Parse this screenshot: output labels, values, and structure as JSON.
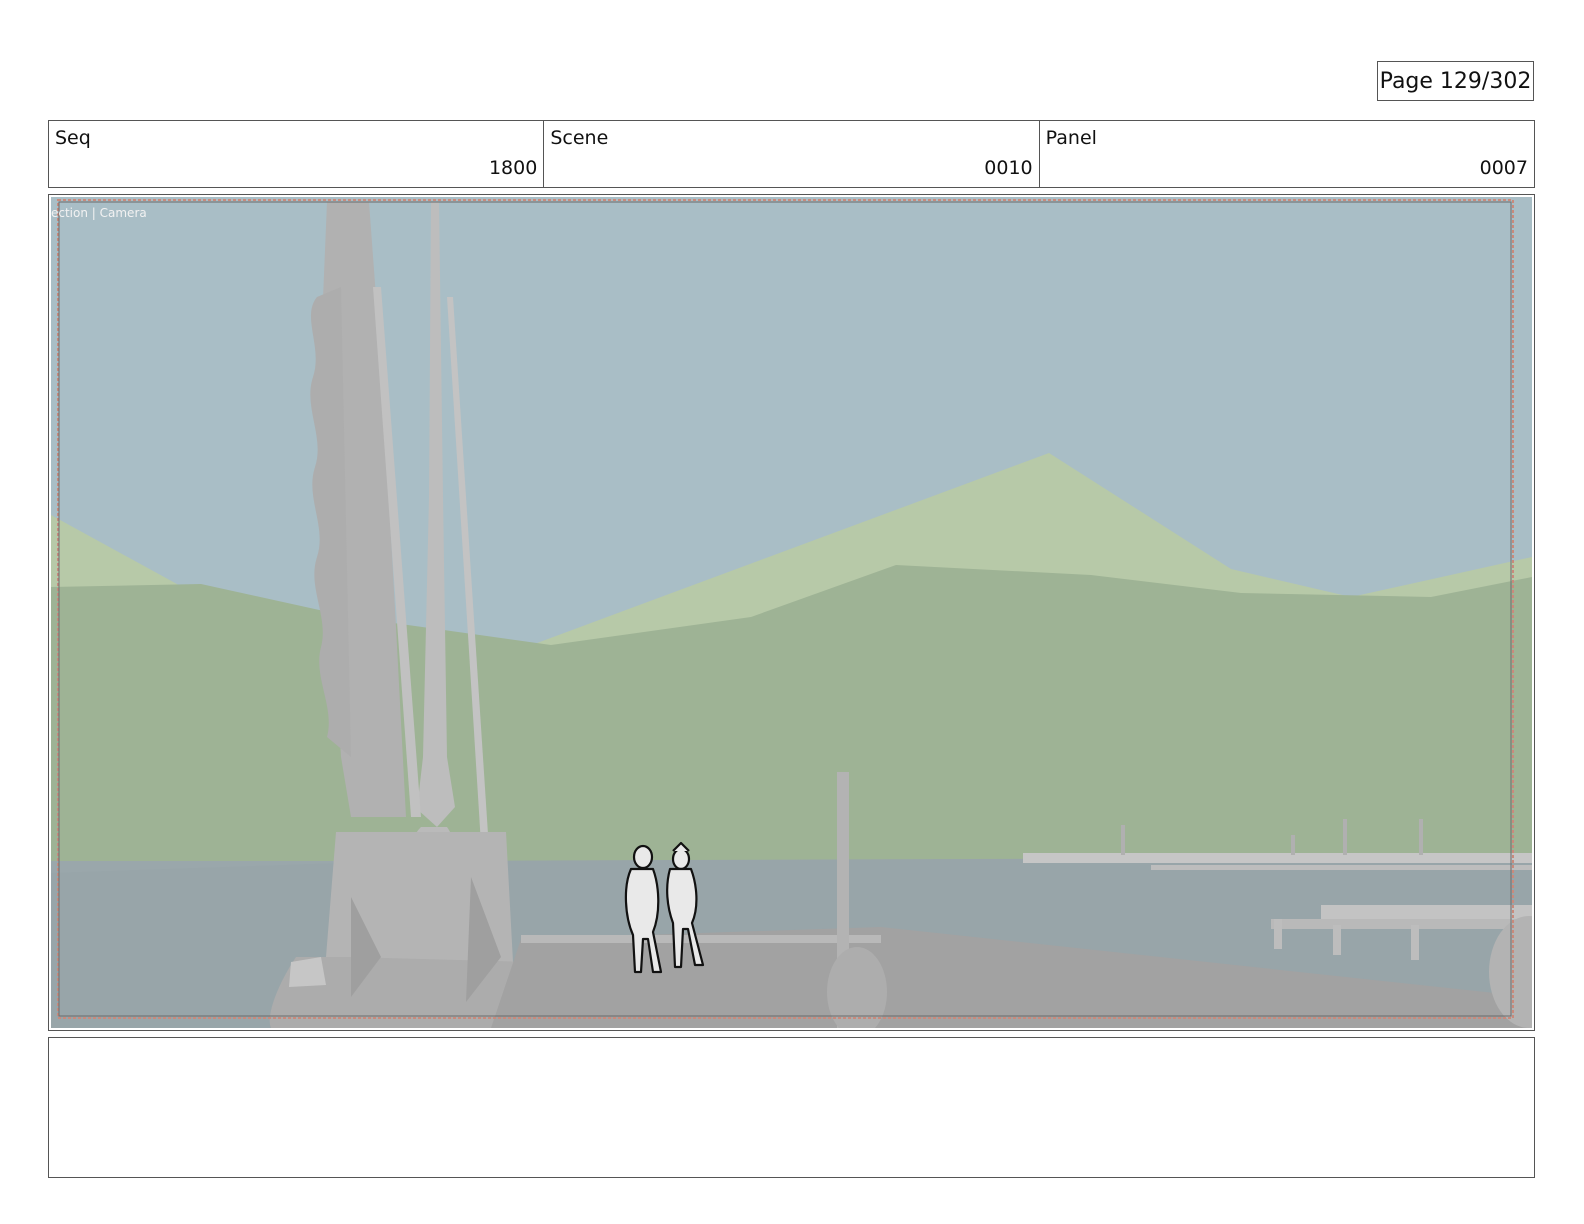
{
  "page": {
    "label": "Page 129/302"
  },
  "header": {
    "seq_label": "Seq",
    "seq_value": "1800",
    "scene_label": "Scene",
    "scene_value": "0010",
    "panel_label": "Panel",
    "panel_value": "0007"
  },
  "frame": {
    "viewport_label": "ection | Camera",
    "colors": {
      "sky": "#a9bec6",
      "far_mountain": "#b7c9a8",
      "near_hills": "#9eb395",
      "water": "#9aa7ab",
      "dock": "#a2a2a2",
      "statue": "#b5b5b5",
      "safe_frame": "#c98a7c"
    },
    "icons": [
      "statue-sculpture",
      "sketched-figures",
      "dock-pier"
    ]
  },
  "notes": {
    "text": ""
  }
}
